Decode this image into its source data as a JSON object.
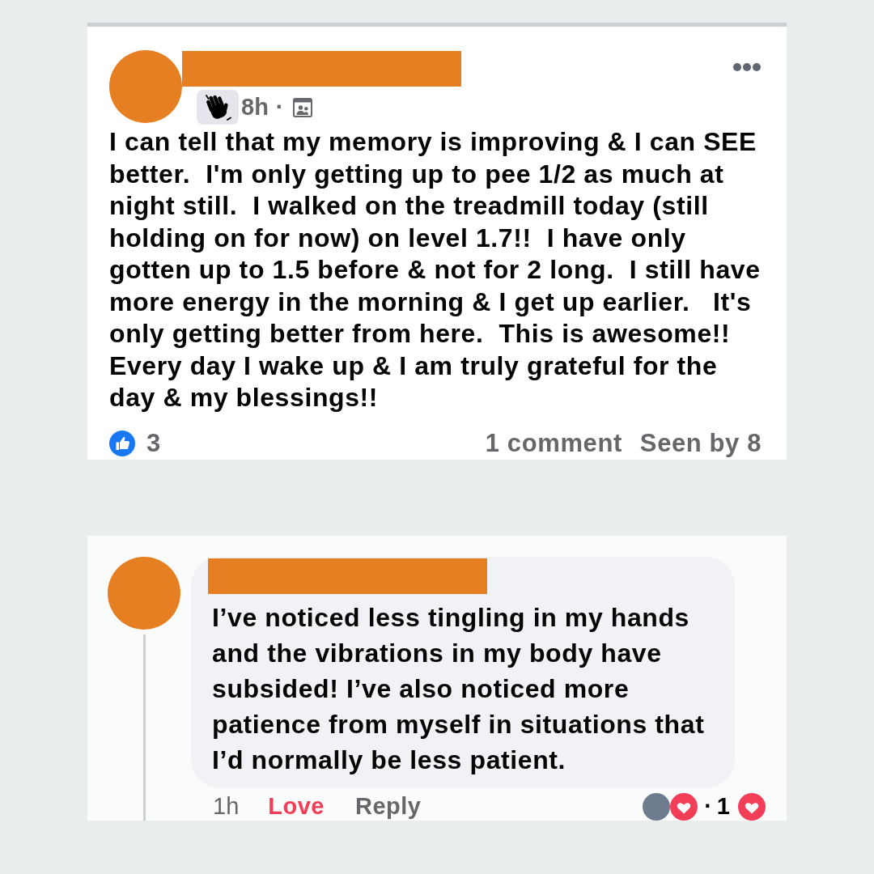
{
  "post": {
    "time": "8h",
    "separator": "·",
    "text": "I can tell that my memory is improving & I can SEE\nbetter.  I'm only getting up to pee 1/2 as much at\nnight still.  I walked on the treadmill today (still\nholding on for now) on level 1.7!!  I have only\ngotten up to 1.5 before & not for 2 long.  I still have\nmore energy in the morning & I get up earlier.   It's\nonly getting better from here.  This is awesome!!\nEvery day I wake up & I am truly grateful for the\nday & my blessings!!",
    "like_count": "3",
    "comments": "1 comment",
    "seen_by": "Seen by 8"
  },
  "comment": {
    "text": "I’ve noticed less tingling in my hands\nand the vibrations in my body have\nsubsided! I’ve also noticed more\npatience from myself in situations that\nI’d normally be less patient.",
    "time": "1h",
    "love": {
      "label": "Love",
      "selected": true
    },
    "reply": "Reply",
    "separator": "·",
    "reaction_count": "1"
  }
}
